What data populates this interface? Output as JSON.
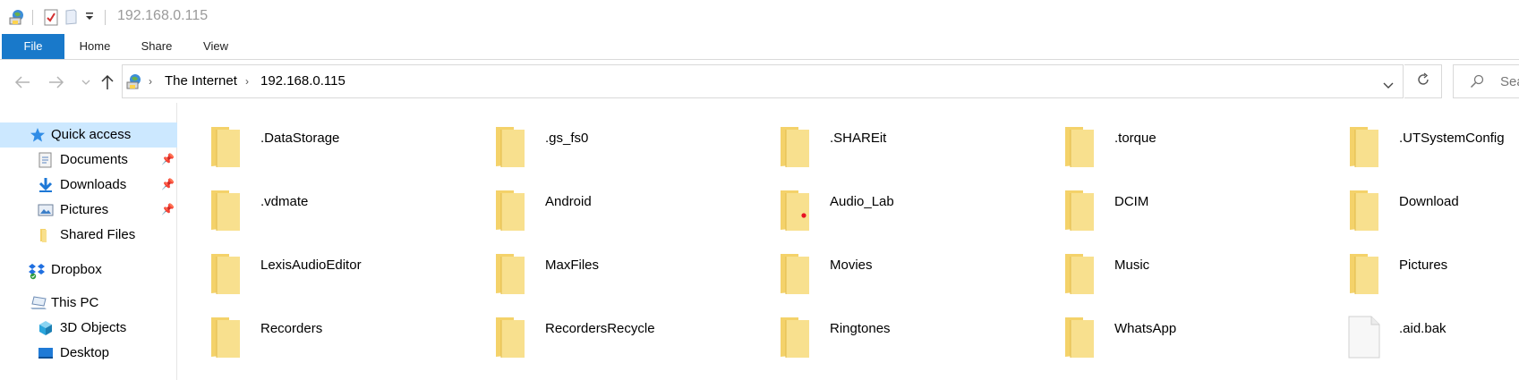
{
  "titlebar": {
    "title": "192.168.0.115",
    "icons": [
      "network-location-icon",
      "properties-icon",
      "new-folder-icon",
      "customize-quick-access-icon"
    ]
  },
  "ribbon": {
    "tabs": [
      {
        "label": "File",
        "active": true
      },
      {
        "label": "Home"
      },
      {
        "label": "Share"
      },
      {
        "label": "View"
      }
    ]
  },
  "nav": {
    "back_icon": "arrow-left-icon",
    "forward_icon": "arrow-right-icon",
    "recent_icon": "chevron-down-icon",
    "up_icon": "arrow-up-icon",
    "breadcrumb": [
      "The Internet",
      "192.168.0.115"
    ],
    "search_placeholder": "Sea"
  },
  "sidebar": {
    "items": [
      {
        "label": "Quick access",
        "icon": "star-icon",
        "active": true
      },
      {
        "label": "Documents",
        "icon": "documents-icon",
        "pinned": true
      },
      {
        "label": "Downloads",
        "icon": "download-arrow-icon",
        "pinned": true
      },
      {
        "label": "Pictures",
        "icon": "pictures-icon",
        "pinned": true
      },
      {
        "label": "Shared Files",
        "icon": "folder-icon"
      },
      {
        "label": "Dropbox",
        "icon": "dropbox-icon"
      },
      {
        "label": "This PC",
        "icon": "computer-icon"
      },
      {
        "label": "3D Objects",
        "icon": "cube-icon"
      },
      {
        "label": "Desktop",
        "icon": "desktop-icon"
      }
    ]
  },
  "files": [
    {
      "name": ".DataStorage",
      "type": "folder"
    },
    {
      "name": ".gs_fs0",
      "type": "folder"
    },
    {
      "name": ".SHAREit",
      "type": "folder"
    },
    {
      "name": ".torque",
      "type": "folder"
    },
    {
      "name": ".UTSystemConfig",
      "type": "folder"
    },
    {
      "name": ".vdmate",
      "type": "folder"
    },
    {
      "name": "Android",
      "type": "folder"
    },
    {
      "name": "Audio_Lab",
      "type": "folder",
      "badge": "red-dot"
    },
    {
      "name": "DCIM",
      "type": "folder"
    },
    {
      "name": "Download",
      "type": "folder"
    },
    {
      "name": "LexisAudioEditor",
      "type": "folder"
    },
    {
      "name": "MaxFiles",
      "type": "folder"
    },
    {
      "name": "Movies",
      "type": "folder"
    },
    {
      "name": "Music",
      "type": "folder"
    },
    {
      "name": "Pictures",
      "type": "folder"
    },
    {
      "name": "Recorders",
      "type": "folder"
    },
    {
      "name": "RecordersRecycle",
      "type": "folder"
    },
    {
      "name": "Ringtones",
      "type": "folder"
    },
    {
      "name": "WhatsApp",
      "type": "folder"
    },
    {
      "name": ".aid.bak",
      "type": "file"
    }
  ],
  "colors": {
    "file_tab": "#1979ca",
    "selection": "#cce8ff",
    "folder": "#f4d26a",
    "folder_front": "#f8e08e",
    "badge": "#e81123"
  }
}
